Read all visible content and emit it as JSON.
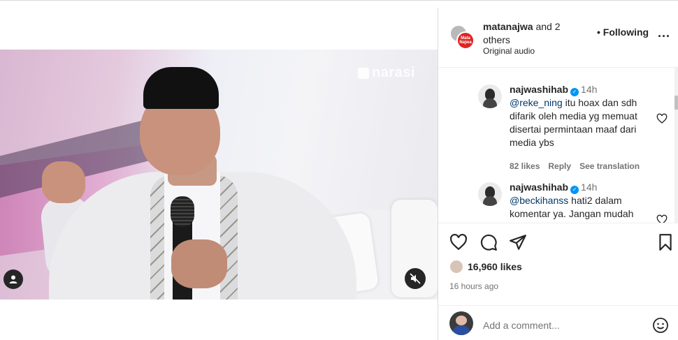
{
  "post": {
    "authors_bold": "matanajwa",
    "authors_rest": " and 2 others",
    "audio": "Original audio",
    "follow_status": "• Following",
    "more": "...",
    "brand_avatar_text": "Mata Najwa"
  },
  "video": {
    "watermark": "narasi"
  },
  "comments": [
    {
      "username": "najwashihab",
      "time": "14h",
      "mention": "@reke_ning",
      "text": " itu hoax dan sdh difarik oleh media yg memuat disertai permintaan maaf dari media ybs",
      "likes": "82 likes",
      "reply": "Reply",
      "translate": "See translation"
    },
    {
      "username": "najwashihab",
      "time": "14h",
      "mention": "@beckihanss",
      "text": " hati2 dalam komentar ya. Jangan mudah"
    }
  ],
  "engagement": {
    "likes": "16,960 likes",
    "posted": "16 hours ago"
  },
  "add_comment": {
    "placeholder": "Add a comment..."
  },
  "colors": {
    "verified": "#0095f6",
    "muted_text": "#737373",
    "mention": "#00376b"
  }
}
